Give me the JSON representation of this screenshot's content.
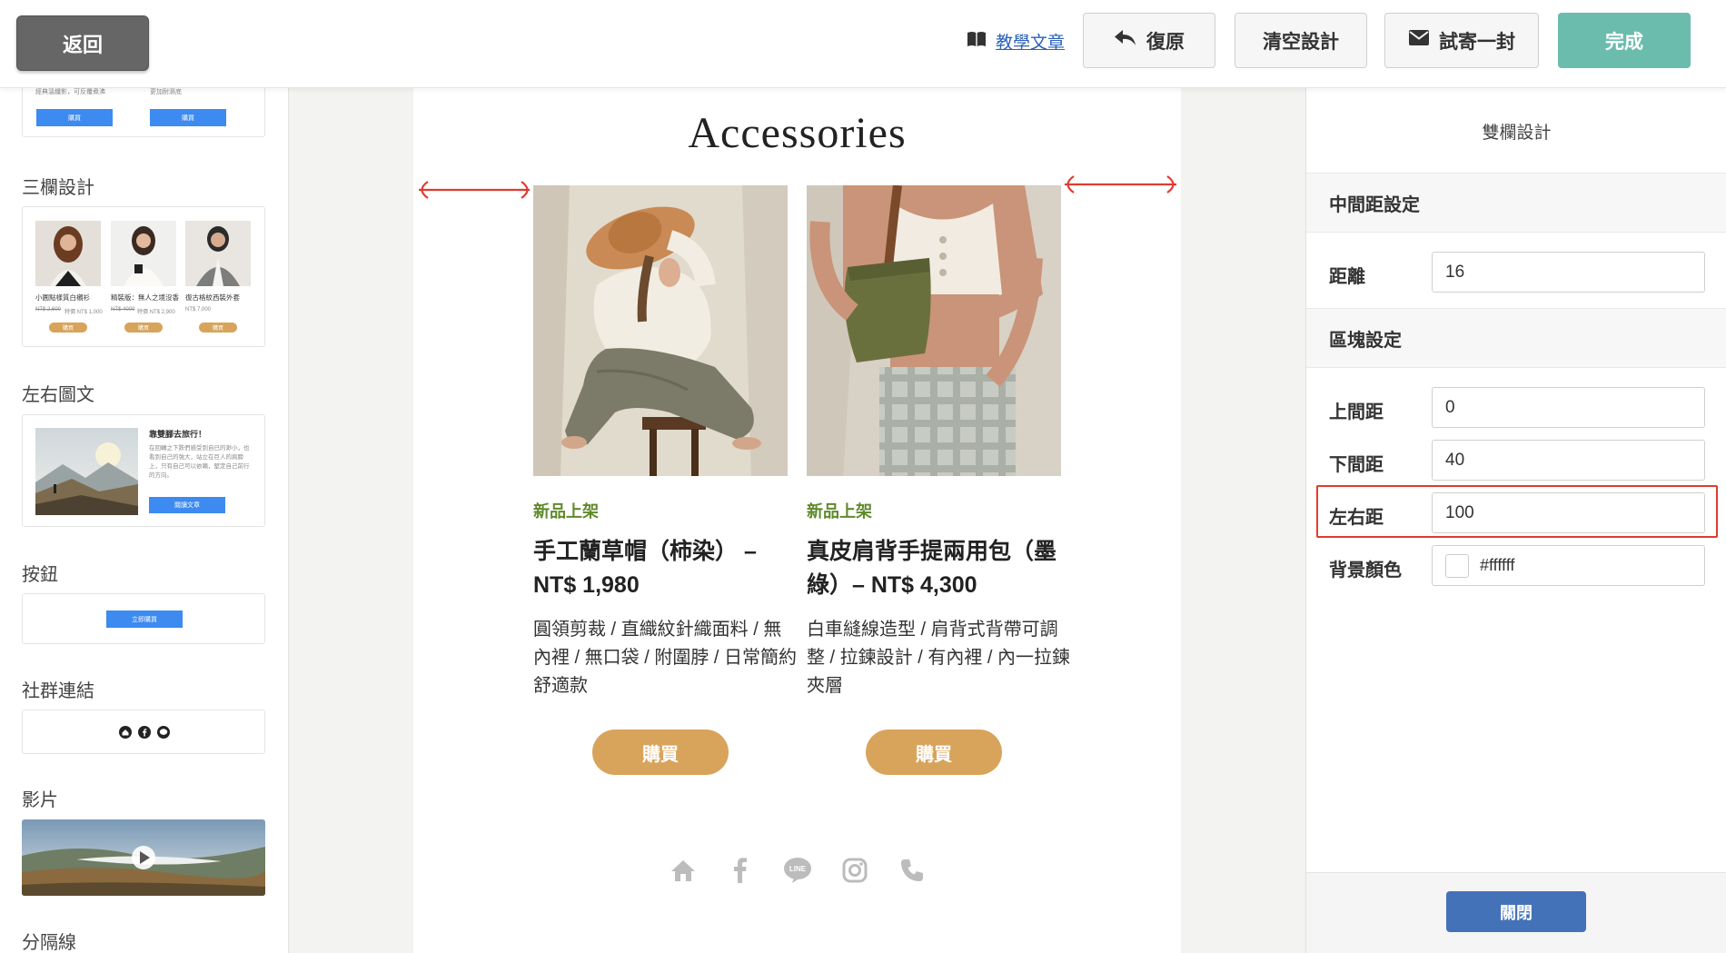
{
  "topbar": {
    "back_label": "返回",
    "tutorial_label": "教學文章",
    "restore_label": "復原",
    "clear_label": "清空設計",
    "test_label": "試寄一封",
    "done_label": "完成"
  },
  "sidebar": {
    "top_block": {
      "text_left": "經典溫纖影，可反覆煮沸",
      "text_right": "更加耐濕底",
      "btn": "購買"
    },
    "three_col": {
      "label": "三欄設計",
      "items": [
        {
          "name": "小圓點樣質白襯衫",
          "price_old": "NT$ 2,600",
          "price": "特價 NT$ 1,000",
          "btn": "購買"
        },
        {
          "name": "精裝版：無人之境沒香",
          "price_old": "NT$ 4000",
          "price": "特價 NT$ 2,900",
          "btn": "購買"
        },
        {
          "name": "復古格紋西裝外套",
          "price_old": "",
          "price": "NT$ 7,000",
          "btn": "購買"
        }
      ]
    },
    "img_text": {
      "label": "左右圖文",
      "title": "靠雙腳去旅行！",
      "body": "在回轉之下跌們感受到自已的渺小，也看到自己的強大，站立在巨人的肩膀上，只有自己可以依賴，堅定自己前行的方向。",
      "btn": "閱讀文章"
    },
    "button_block": {
      "label": "按鈕",
      "btn": "立即購買"
    },
    "social_block": {
      "label": "社群連結"
    },
    "video_block": {
      "label": "影片"
    },
    "divider_block": {
      "label": "分隔線"
    }
  },
  "canvas": {
    "title": "Accessories",
    "products": [
      {
        "tag": "新品上架",
        "name": "手工蘭草帽（柿染） – NT$ 1,980",
        "desc": "圓領剪裁 / 直織紋針織面料 / 無內裡 / 無口袋 / 附圍脖 / 日常簡約舒適款",
        "buy": "購買"
      },
      {
        "tag": "新品上架",
        "name": "真皮肩背手提兩用包（墨綠）– NT$ 4,300",
        "desc": "白車縫線造型 / 肩背式背帶可調整 / 拉鍊設計 / 有內裡 / 內一拉鍊夾層",
        "buy": "購買"
      }
    ],
    "social_icons": [
      "home-icon",
      "facebook-icon",
      "line-icon",
      "instagram-icon",
      "phone-icon"
    ],
    "line_text": "LINE"
  },
  "panel": {
    "title": "雙欄設計",
    "gap_section": "中間距設定",
    "gap_label": "距離",
    "gap_value": "16",
    "block_section": "區塊設定",
    "top_label": "上間距",
    "top_value": "0",
    "bottom_label": "下間距",
    "bottom_value": "40",
    "side_label": "左右距",
    "side_value": "100",
    "bg_label": "背景顏色",
    "bg_value": "#ffffff",
    "close_label": "關閉"
  },
  "colors": {
    "accent_gold": "#d8a45b",
    "tag_green": "#5f8a2b",
    "done_teal": "#6cbcae",
    "close_blue": "#4472b8",
    "annotation_red": "#e03b30"
  }
}
